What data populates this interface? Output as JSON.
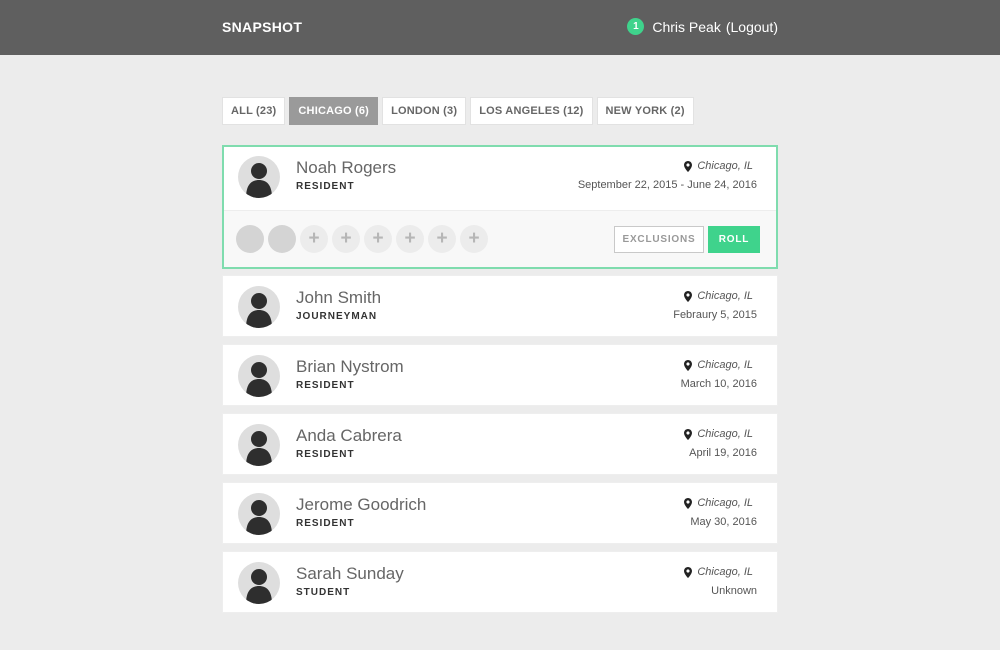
{
  "header": {
    "brand": "SNAPSHOT",
    "notification_count": "1",
    "user_name": "Chris Peak",
    "logout_label": "(Logout)"
  },
  "tabs": [
    {
      "label": "ALL (23)",
      "active": false
    },
    {
      "label": "CHICAGO (6)",
      "active": true
    },
    {
      "label": "LONDON (3)",
      "active": false
    },
    {
      "label": "LOS ANGELES (12)",
      "active": false
    },
    {
      "label": "NEW YORK (2)",
      "active": false
    }
  ],
  "people": [
    {
      "name": "Noah Rogers",
      "role": "RESIDENT",
      "location": "Chicago, IL",
      "date": "September 22, 2015 - June 24, 2016",
      "expanded": true
    },
    {
      "name": "John Smith",
      "role": "JOURNEYMAN",
      "location": "Chicago, IL",
      "date": "Febraury 5, 2015"
    },
    {
      "name": "Brian Nystrom",
      "role": "RESIDENT",
      "location": "Chicago, IL",
      "date": "March 10, 2016"
    },
    {
      "name": "Anda Cabrera",
      "role": "RESIDENT",
      "location": "Chicago, IL",
      "date": "April 19, 2016"
    },
    {
      "name": "Jerome Goodrich",
      "role": "RESIDENT",
      "location": "Chicago, IL",
      "date": "May 30, 2016"
    },
    {
      "name": "Sarah Sunday",
      "role": "STUDENT",
      "location": "Chicago, IL",
      "date": "Unknown"
    }
  ],
  "expanded_card": {
    "filled_slots": 2,
    "add_slots": 6,
    "add_symbol": "+",
    "exclusions_label": "EXCLUSIONS",
    "roll_label": "ROLL"
  },
  "colors": {
    "accent": "#3fd38c",
    "header_bg": "#5f5f5f",
    "page_bg": "#ececec"
  },
  "icons": {
    "avatar": "person-silhouette-icon",
    "location": "map-pin-icon",
    "add": "plus-icon"
  }
}
